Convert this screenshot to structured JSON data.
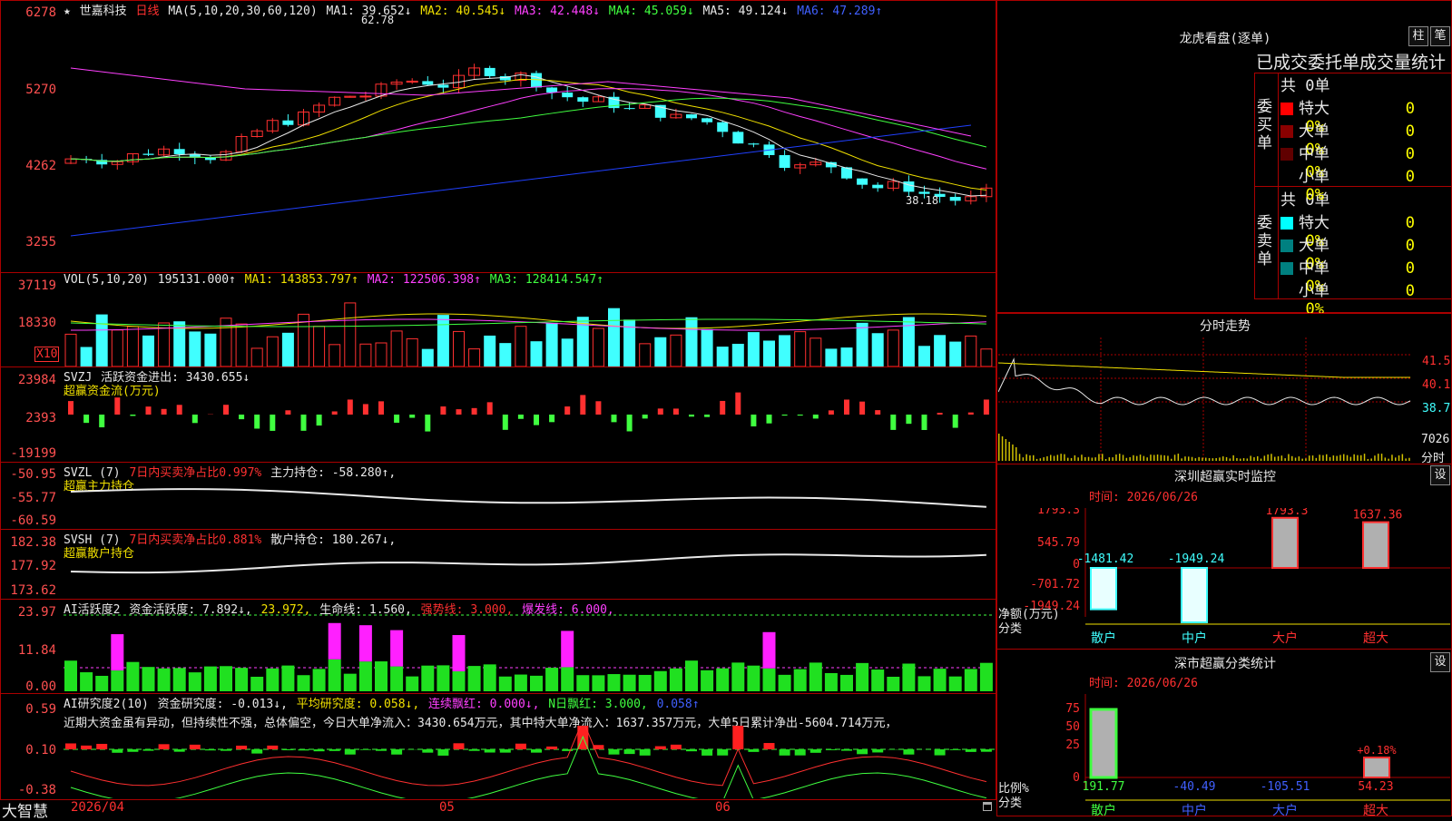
{
  "stock": {
    "star": "★",
    "name": "世嘉科技",
    "period": "日线"
  },
  "header": {
    "ma_title": "MA(5,10,20,30,60,120)",
    "ma1": "MA1: 39.652↓",
    "ma2": "MA2: 40.545↓",
    "ma3": "MA3: 42.448↓",
    "ma4": "MA4: 45.059↓",
    "ma5": "MA5: 49.124↓",
    "ma6": "MA6: 47.289↑"
  },
  "main_axis": [
    "6278",
    "5270",
    "4262",
    "3255"
  ],
  "price_annotations": {
    "high": "62.78",
    "low": "38.18"
  },
  "vol": {
    "title": "VOL(5,10,20)",
    "value": "195131.000↑",
    "ma1": "MA1: 143853.797↑",
    "ma2": "MA2: 122506.398↑",
    "ma3": "MA3: 128414.547↑",
    "unit": "X10",
    "axis": [
      "37119",
      "18330"
    ]
  },
  "svzj": {
    "title": "SVZJ",
    "label": "活跃资金进出: 3430.655↓",
    "sub": "超赢资金流(万元)",
    "axis": [
      "23984",
      "2393",
      "-19199"
    ]
  },
  "svzl": {
    "title": "SVZL (7)",
    "ratio": "7日内买卖净占比0.997%",
    "label": "主力持仓: -58.280↑,",
    "sub": "超赢主力持仓",
    "axis": [
      "-50.95",
      "-55.77",
      "-60.59"
    ]
  },
  "svsh": {
    "title": "SVSH (7)",
    "ratio": "7日内买卖净占比0.881%",
    "label": "散户持仓: 180.267↓,",
    "sub": "超赢散户持仓",
    "axis": [
      "182.38",
      "177.92",
      "173.62"
    ]
  },
  "ai1": {
    "title": "AI活跃度2",
    "l1": "资金活跃度: 7.892↓,",
    "l2": "23.972,",
    "l3": "生命线: 1.560,",
    "l4": "强势线: 3.000,",
    "l5": "爆发线: 6.000,",
    "axis": [
      "23.97",
      "11.84",
      "0.00"
    ]
  },
  "ai2": {
    "title": "AI研究度2(10)",
    "l1": "资金研究度: -0.013↓,",
    "l2": "平均研究度: 0.058↓,",
    "l3": "连续飘红: 0.000↓,",
    "l4": "N日飘红: 3.000,",
    "l5": "0.058↑",
    "comment": "近期大资金虽有异动，但持续性不强，总体偏空，今日大单净流入：3430.654万元，其中特大单净流入：1637.357万元，大单5日累计净出-5604.714万元，",
    "axis": [
      "0.59",
      "0.10",
      "-0.38"
    ]
  },
  "xaxis": {
    "brand": "大智慧",
    "d1": "2026/04",
    "d2": "05",
    "d3": "06"
  },
  "dragon": {
    "title": "龙虎看盘(逐单)",
    "btn_bar": "柱",
    "btn_trade": "笔",
    "subtitle": "已成交委托单成交量统计",
    "buy_label": "委买单",
    "sell_label": "委卖单",
    "buy_total": "共 0单",
    "sell_total": "共 0单",
    "buy_rows": [
      {
        "name": "特大",
        "qty": "0",
        "pct": "0%",
        "color": "#ff0000"
      },
      {
        "name": "大单",
        "qty": "0",
        "pct": "0%",
        "color": "#8a0000"
      },
      {
        "name": "中单",
        "qty": "0",
        "pct": "0%",
        "color": "#600000"
      },
      {
        "name": "小单",
        "qty": "0",
        "pct": "0%",
        "color": "#000000"
      }
    ],
    "sell_rows": [
      {
        "name": "特大",
        "qty": "0",
        "pct": "0%",
        "color": "#00ffff"
      },
      {
        "name": "大单",
        "qty": "0",
        "pct": "0%",
        "color": "#008080"
      },
      {
        "name": "中单",
        "qty": "0",
        "pct": "0%",
        "color": "#008080"
      },
      {
        "name": "小单",
        "qty": "0",
        "pct": "0%",
        "color": "#000000"
      }
    ]
  },
  "intraday": {
    "title": "分时走势",
    "axis": [
      "41.5",
      "40.1",
      "38.7"
    ],
    "vol": "7026",
    "vol_unit": "分时"
  },
  "monitor": {
    "title": "深圳超赢实时监控",
    "btn": "设",
    "time": "时间: 2026/06/26",
    "axis": [
      "1793.3",
      "545.79",
      "0",
      "-701.72",
      "-1949.24"
    ],
    "ylabel": "净额(万元)",
    "xlabel": "分类",
    "cats": [
      "散户",
      "中户",
      "大户",
      "超大"
    ],
    "values": [
      -1481.42,
      -1949.24,
      1793.3,
      1637.36
    ],
    "value_labels": [
      "-1481.42",
      "-1949.24",
      "1793.3",
      "1637.36"
    ]
  },
  "classify": {
    "title": "深市超赢分类统计",
    "btn": "设",
    "time": "时间: 2026/06/26",
    "axis": [
      "75",
      "50",
      "25",
      "0"
    ],
    "ylabel": "比例%",
    "xlabel": "分类",
    "cats": [
      "散户",
      "中户",
      "大户",
      "超大"
    ],
    "bar_labels": [
      "191.77",
      "-40.49",
      "-105.51",
      "54.23"
    ],
    "pct_label": "+0.18%"
  }
}
